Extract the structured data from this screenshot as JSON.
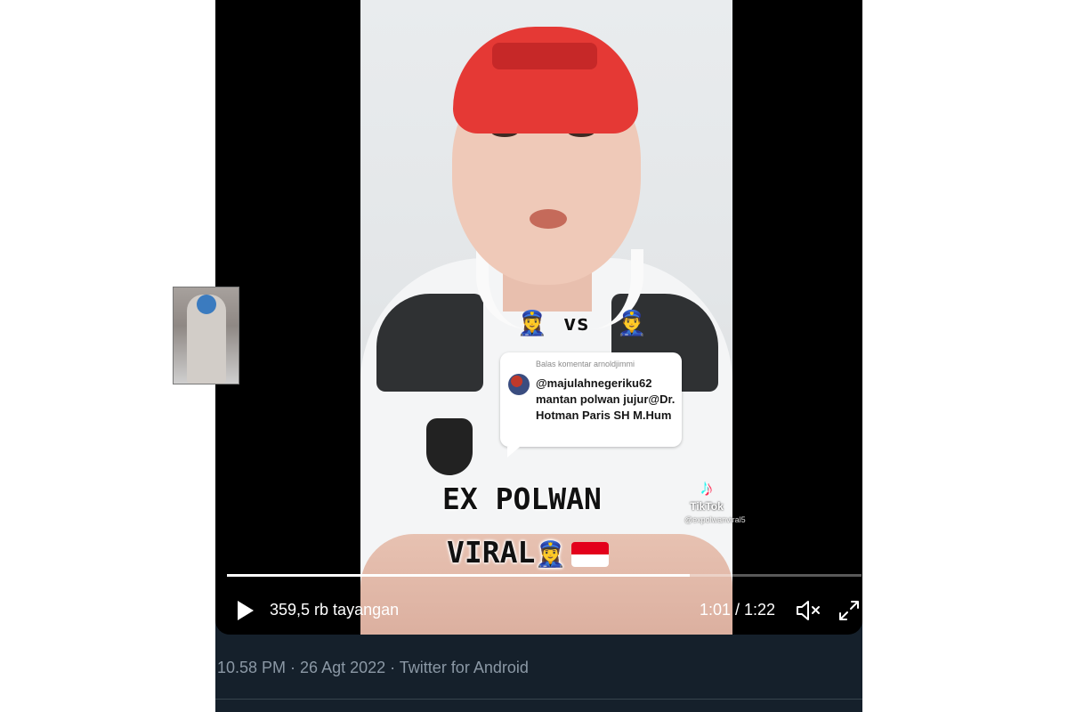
{
  "video": {
    "emojis": {
      "left": "👮‍♀️",
      "right": "👮‍♂️",
      "caption": "👮‍♀️"
    },
    "vs_text": "vs",
    "reply": {
      "header": "Balas komentar arnoldjimmi",
      "body": "@majulahnegeriku62 mantan polwan jujur@Dr. Hotman Paris SH M.Hum"
    },
    "caption_line1": "EX POLWAN",
    "caption_line2": "VIRAL",
    "watermark": {
      "brand": "TikTok",
      "username": "@expolwanviral5",
      "logo_glyph": "♪"
    },
    "flag": "indonesia-flag"
  },
  "player": {
    "views": "359,5 rb tayangan",
    "time": "1:01 / 1:22",
    "progress": 0.73,
    "play_icon": "play-icon",
    "mute_icon": "speaker-muted-icon",
    "fullscreen_icon": "fullscreen-icon",
    "colors": {
      "progress_fill": "#ffffff",
      "background": "#15202b",
      "meta_text": "#8b98a5"
    }
  },
  "tweet": {
    "meta": "10.58 PM · 26 Agt 2022 · Twitter for Android"
  }
}
